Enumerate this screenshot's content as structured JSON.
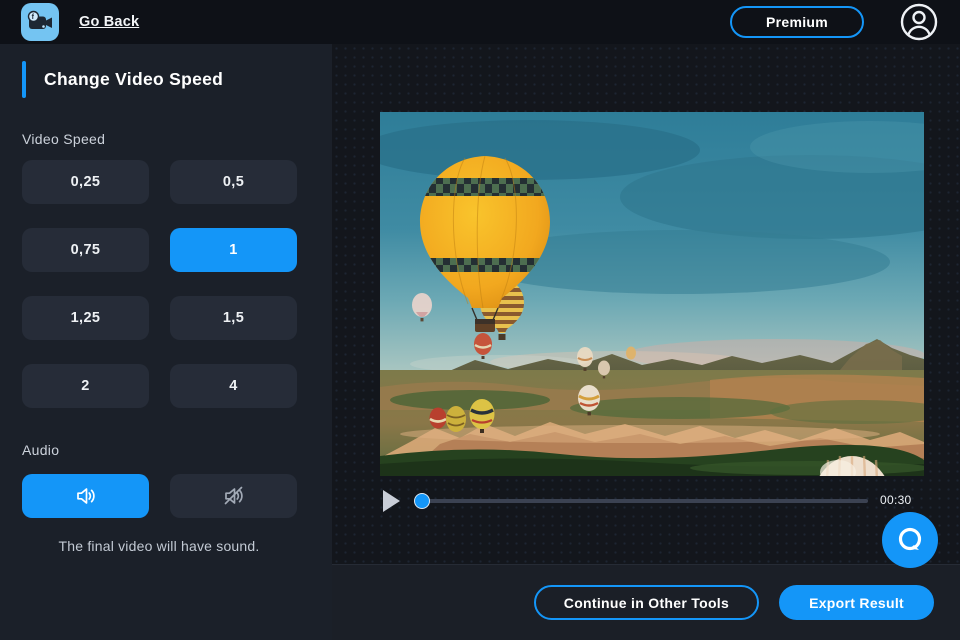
{
  "topbar": {
    "go_back_label": "Go Back",
    "premium_label": "Premium"
  },
  "sidebar": {
    "title": "Change Video Speed",
    "speed_label": "Video Speed",
    "speeds": [
      {
        "label": "0,25",
        "selected": false
      },
      {
        "label": "0,5",
        "selected": false
      },
      {
        "label": "0,75",
        "selected": false
      },
      {
        "label": "1",
        "selected": true
      },
      {
        "label": "1,25",
        "selected": false
      },
      {
        "label": "1,5",
        "selected": false
      },
      {
        "label": "2",
        "selected": false
      },
      {
        "label": "4",
        "selected": false
      }
    ],
    "audio_label": "Audio",
    "audio": {
      "options": [
        {
          "name": "sound-on",
          "selected": true
        },
        {
          "name": "sound-off",
          "selected": false
        }
      ]
    },
    "audio_note": "The final video will have sound."
  },
  "player": {
    "duration": "00:30",
    "progress_percent": 0
  },
  "footer": {
    "continue_label": "Continue in Other Tools",
    "export_label": "Export Result"
  },
  "icons": {
    "logo": "video-camera-icon",
    "avatar": "user-avatar-icon",
    "sound_on": "speaker-icon",
    "sound_off": "speaker-muted-icon",
    "play": "play-icon",
    "chat": "chat-bubble-icon"
  },
  "colors": {
    "accent": "#1496f8",
    "panel": "#1b2029",
    "button_dark": "#262c38",
    "topbar": "#0e1117"
  }
}
